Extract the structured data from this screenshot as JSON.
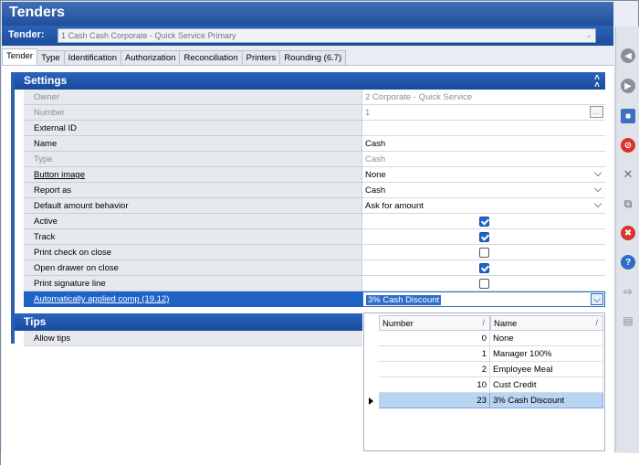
{
  "window": {
    "title": "Tenders"
  },
  "tender": {
    "label": "Tender:",
    "selected": "1 Cash Cash Corporate - Quick Service Primary"
  },
  "tabs": [
    {
      "label": "Tender"
    },
    {
      "label": "Type"
    },
    {
      "label": "Identification"
    },
    {
      "label": "Authorization"
    },
    {
      "label": "Reconciliation"
    },
    {
      "label": "Printers"
    },
    {
      "label": "Rounding (6.7)"
    }
  ],
  "settings": {
    "header": "Settings",
    "rows": [
      {
        "label": "Owner",
        "value": "2  Corporate - Quick Service"
      },
      {
        "label": "Number",
        "value": "1",
        "button": "..."
      },
      {
        "label": "External ID",
        "value": ""
      },
      {
        "label": "Name",
        "value": "Cash"
      },
      {
        "label": "Type",
        "value": "Cash"
      },
      {
        "label": "Button image",
        "value": "None"
      },
      {
        "label": "Report as",
        "value": "Cash"
      },
      {
        "label": "Default amount behavior",
        "value": "Ask for amount"
      },
      {
        "label": "Active",
        "checked": true
      },
      {
        "label": "Track",
        "checked": true
      },
      {
        "label": "Print check on close",
        "checked": false
      },
      {
        "label": "Open drawer on close",
        "checked": true
      },
      {
        "label": "Print signature line",
        "checked": false
      },
      {
        "label": "Automatically applied comp (19.12)",
        "value": "3% Cash Discount"
      }
    ]
  },
  "tips": {
    "header": "Tips",
    "rows": [
      {
        "label": "Allow tips"
      }
    ]
  },
  "dropdown": {
    "columns": [
      {
        "label": "Number"
      },
      {
        "label": "Name"
      }
    ],
    "items": [
      {
        "number": "0",
        "name": "None"
      },
      {
        "number": "1",
        "name": "Manager 100%"
      },
      {
        "number": "2",
        "name": "Employee Meal"
      },
      {
        "number": "10",
        "name": "Cust Credit"
      },
      {
        "number": "23",
        "name": "3% Cash Discount"
      }
    ],
    "selected_index": 4
  },
  "sidebar_icons": [
    {
      "name": "back-icon",
      "color": "#8a8f98"
    },
    {
      "name": "forward-icon",
      "color": "#8a8f98"
    },
    {
      "name": "save-icon",
      "color": "#3e6fc0"
    },
    {
      "name": "no-entry-icon",
      "color": "#d9342b"
    },
    {
      "name": "close-x-icon",
      "color": "#6a6f78"
    },
    {
      "name": "copy-icon",
      "color": "#8a8f98"
    },
    {
      "name": "delete-icon",
      "color": "#d9342b"
    },
    {
      "name": "help-icon",
      "color": "#2e6cc8"
    },
    {
      "name": "export-icon",
      "color": "#8a8f98"
    },
    {
      "name": "report-icon",
      "color": "#8a8f98"
    }
  ]
}
